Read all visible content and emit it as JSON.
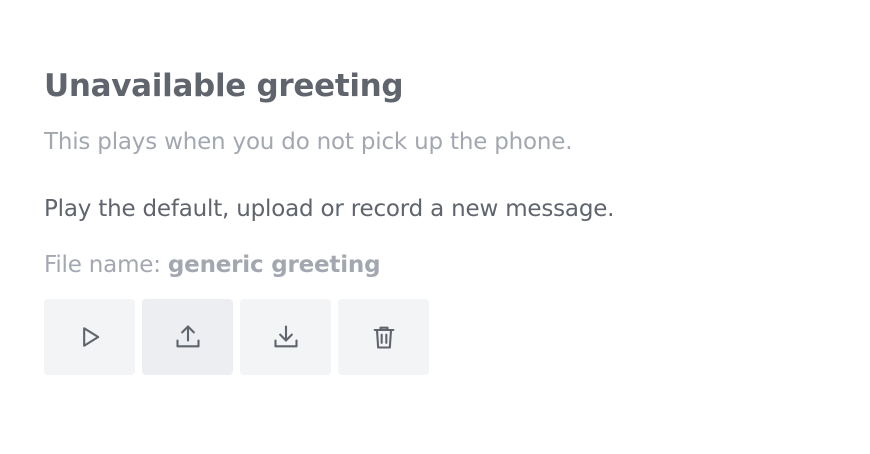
{
  "greeting": {
    "title": "Unavailable greeting",
    "subtitle": "This plays when you do not pick up the phone.",
    "instruction": "Play the default, upload or record a new message.",
    "file_label": "File name:",
    "file_name": "generic greeting"
  },
  "actions": [
    {
      "name": "play",
      "icon": "play-icon"
    },
    {
      "name": "upload",
      "icon": "upload-icon"
    },
    {
      "name": "download",
      "icon": "download-icon"
    },
    {
      "name": "delete",
      "icon": "trash-icon"
    }
  ],
  "colors": {
    "heading": "#5f646d",
    "muted": "#a3a8b0",
    "button_bg": "#f3f4f6"
  }
}
